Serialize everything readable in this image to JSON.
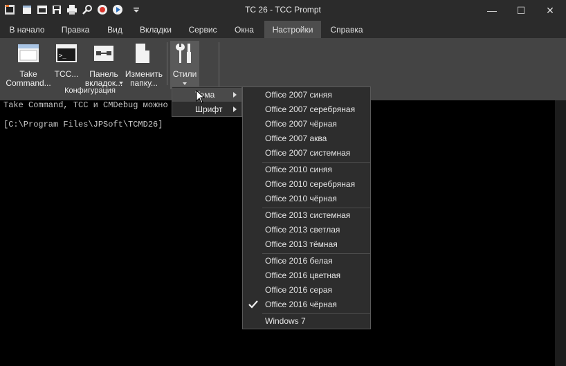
{
  "window": {
    "title": "TC 26 - TCC Prompt",
    "controls": {
      "minimize": "—",
      "maximize": "☐",
      "close": "✕"
    }
  },
  "menu_tabs": [
    {
      "label": "В начало"
    },
    {
      "label": "Правка"
    },
    {
      "label": "Вид"
    },
    {
      "label": "Вкладки"
    },
    {
      "label": "Сервис"
    },
    {
      "label": "Окна"
    },
    {
      "label": "Настройки",
      "active": true
    },
    {
      "label": "Справка"
    }
  ],
  "ribbon": {
    "buttons": [
      {
        "label_1": "Take",
        "label_2": "Command..."
      },
      {
        "label_1": "TCC..."
      },
      {
        "label_1": "Панель",
        "label_2": "вкладок..."
      },
      {
        "label_1": "Изменить",
        "label_2": "папку..."
      },
      {
        "label_1": "Стили"
      }
    ],
    "group_label": "Конфигурация"
  },
  "console": {
    "lines": [
      "Take Command, TCC и CMDebug можно куп",
      "[C:\\Program Files\\JPSoft\\TCMD26]"
    ]
  },
  "styles_submenu": {
    "items": [
      {
        "label": "Тема"
      },
      {
        "label": "Шрифт"
      }
    ]
  },
  "theme_menu": {
    "items": [
      "Office 2007 синяя",
      "Office 2007 серебряная",
      "Office 2007 чёрная",
      "Office 2007 аква",
      "Office 2007 системная",
      "Office 2010 синяя",
      "Office 2010 серебряная",
      "Office 2010 чёрная",
      "Office 2013 системная",
      "Office 2013 светлая",
      "Office 2013 тёмная",
      "Office 2016 белая",
      "Office 2016 цветная",
      "Office 2016 серая",
      "Office 2016 чёрная",
      "Windows 7"
    ],
    "checked": "Office 2016 чёрная"
  },
  "colors": {
    "titlebar": "#2b2b2b",
    "ribbon": "#444444",
    "active_tab": "#4d4d4d",
    "menu_bg": "#2d2d2d",
    "accent_orange": "#e8762d"
  }
}
